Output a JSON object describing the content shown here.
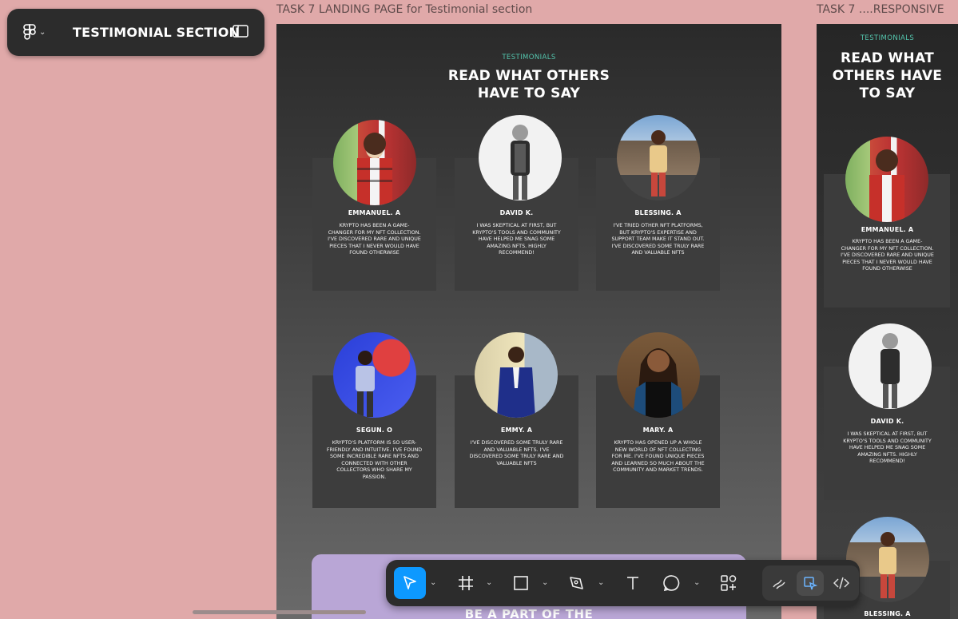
{
  "file": {
    "title": "TESTIMONIAL SECTION",
    "menu_icon": "figma-logo-icon",
    "panel_icon": "sidebar-panel-icon"
  },
  "frames": {
    "main_label": "TASK 7 LANDING PAGE for Testimonial section",
    "responsive_label": "TASK 7 ....RESPONSIVE"
  },
  "section": {
    "eyebrow": "TESTIMONIALS",
    "headline_line1": "READ WHAT OTHERS",
    "headline_line2": "HAVE TO SAY",
    "responsive_line1": "READ WHAT",
    "responsive_line2": "OTHERS HAVE",
    "responsive_line3": "TO SAY"
  },
  "testimonials": [
    {
      "name": "EMMANUEL. A",
      "lines": [
        "KRYPTO HAS BEEN A GAME-",
        "CHANGER FOR MY NFT COLLECTION.",
        "I'VE DISCOVERED RARE AND UNIQUE",
        "PIECES THAT I NEVER WOULD HAVE",
        "FOUND OTHERWISE"
      ]
    },
    {
      "name": "DAVID K.",
      "lines": [
        "I WAS SKEPTICAL AT FIRST, BUT",
        "KRYPTO'S TOOLS AND COMMUNITY",
        "HAVE HELPED ME SNAG SOME",
        "AMAZING NFTS. HIGHLY",
        "RECOMMEND!"
      ]
    },
    {
      "name": "BLESSING. A",
      "lines": [
        "I'VE TRIED OTHER NFT PLATFORMS,",
        "BUT KRYPTO'S EXPERTISE AND",
        "SUPPORT TEAM MAKE IT STAND OUT.",
        "I'VE DISCOVERED SOME TRULY RARE",
        "AND VALUABLE NFTS"
      ]
    },
    {
      "name": "SEGUN. O",
      "lines": [
        "KRYPTO'S PLATFORM IS SO USER-",
        "FRIENDLY AND INTUITIVE. I'VE FOUND",
        "SOME INCREDIBLE RARE NFTS AND",
        "CONNECTED WITH OTHER",
        "COLLECTORS WHO SHARE MY",
        "PASSION."
      ]
    },
    {
      "name": "EMMY. A",
      "lines": [
        "I'VE DISCOVERED SOME TRULY RARE",
        "AND VALUABLE NFTS. I'VE",
        "DISCOVERED SOME TRULY RARE AND",
        "VALUABLE NFTS"
      ]
    },
    {
      "name": "MARY. A",
      "lines": [
        "KRYPTO HAS OPENED UP A WHOLE",
        "NEW WORLD OF NFT COLLECTING",
        "FOR ME. I'VE FOUND UNIQUE PIECES",
        "AND LEARNED SO MUCH ABOUT THE",
        "COMMUNITY AND MARKET TRENDS."
      ]
    }
  ],
  "cta": {
    "text": "BE A PART OF THE"
  },
  "toolbar": {
    "tools": [
      "move-tool",
      "frame-tool",
      "shape-tool",
      "pen-tool",
      "text-tool",
      "comment-tool",
      "actions-tool"
    ],
    "right_tools": [
      "draw-mode",
      "design-mode",
      "dev-mode"
    ],
    "active_tool": "move-tool",
    "selected_mode": "design-mode"
  },
  "colors": {
    "canvas": "#e0a9a9",
    "accent": "#0d99ff",
    "eyebrow": "#54c6ae",
    "card": "#3d3d3d",
    "cta": "#b9a6d6"
  }
}
